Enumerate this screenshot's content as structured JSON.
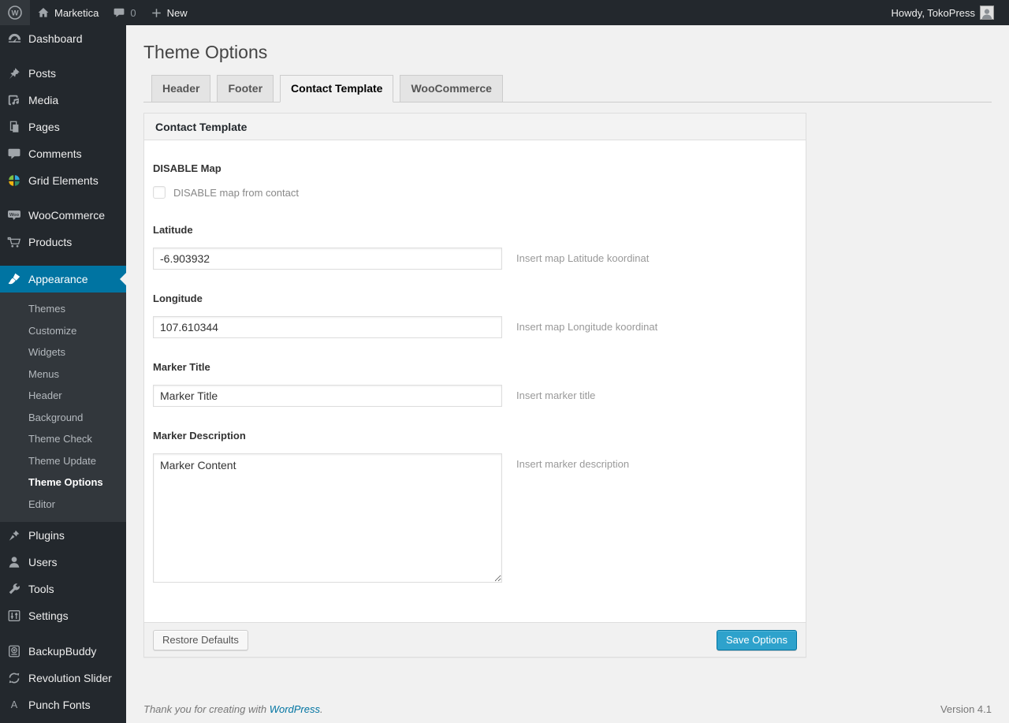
{
  "colors": {
    "accent": "#0074a2",
    "primary_button": "#2ea2cc",
    "link": "#0074a2"
  },
  "admin_bar": {
    "site_name": "Marketica",
    "comment_count": "0",
    "new_label": "New",
    "howdy": "Howdy, TokoPress"
  },
  "sidebar": {
    "items": [
      {
        "label": "Dashboard"
      },
      {
        "label": "Posts"
      },
      {
        "label": "Media"
      },
      {
        "label": "Pages"
      },
      {
        "label": "Comments"
      },
      {
        "label": "Grid Elements"
      },
      {
        "label": "WooCommerce"
      },
      {
        "label": "Products"
      },
      {
        "label": "Appearance",
        "current": true
      },
      {
        "label": "Plugins"
      },
      {
        "label": "Users"
      },
      {
        "label": "Tools"
      },
      {
        "label": "Settings"
      },
      {
        "label": "BackupBuddy"
      },
      {
        "label": "Revolution Slider"
      },
      {
        "label": "Punch Fonts"
      }
    ],
    "appearance_submenu": [
      {
        "label": "Themes"
      },
      {
        "label": "Customize"
      },
      {
        "label": "Widgets"
      },
      {
        "label": "Menus"
      },
      {
        "label": "Header"
      },
      {
        "label": "Background"
      },
      {
        "label": "Theme Check"
      },
      {
        "label": "Theme Update"
      },
      {
        "label": "Theme Options",
        "current": true
      },
      {
        "label": "Editor"
      }
    ]
  },
  "page": {
    "title": "Theme Options",
    "tabs": [
      {
        "label": "Header",
        "active": false
      },
      {
        "label": "Footer",
        "active": false
      },
      {
        "label": "Contact Template",
        "active": true
      },
      {
        "label": "WooCommerce",
        "active": false
      }
    ],
    "panel": {
      "header": "Contact Template",
      "fields": {
        "disable_map": {
          "label": "DISABLE Map",
          "checkbox_label": "DISABLE map from contact",
          "checked": false
        },
        "latitude": {
          "label": "Latitude",
          "value": "-6.903932",
          "hint": "Insert map Latitude koordinat"
        },
        "longitude": {
          "label": "Longitude",
          "value": "107.610344",
          "hint": "Insert map Longitude koordinat"
        },
        "marker_title": {
          "label": "Marker Title",
          "value": "Marker Title",
          "hint": "Insert marker title"
        },
        "marker_description": {
          "label": "Marker Description",
          "value": "Marker Content",
          "hint": "Insert marker description"
        }
      },
      "buttons": {
        "restore": "Restore Defaults",
        "save": "Save Options"
      }
    }
  },
  "footer": {
    "thanks_text": "Thank you for creating with ",
    "wordpress_link": "WordPress",
    "period": ".",
    "version": "Version 4.1"
  }
}
